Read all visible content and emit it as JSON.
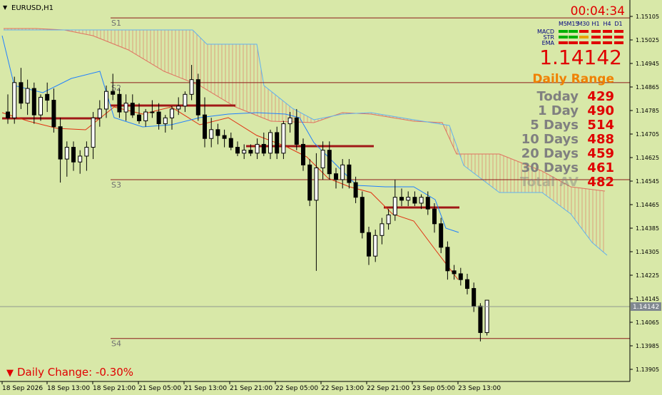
{
  "window": {
    "symbol_title": "EURUSD,H1",
    "timer": "00:04:34",
    "current_price": "1.14142",
    "price_label": "1.14142"
  },
  "indicators": {
    "timeframes": [
      "M5",
      "M15",
      "M30",
      "H1",
      "H4",
      "D1"
    ],
    "rows": [
      {
        "name": "MACD",
        "colors": [
          "#00b000",
          "#00b000",
          "#e00000",
          "#e00000",
          "#e00000",
          "#e00000"
        ]
      },
      {
        "name": "STR",
        "colors": [
          "#00b000",
          "#00b000",
          "#e8a000",
          "#e00000",
          "#e00000",
          "#e00000"
        ]
      },
      {
        "name": "EMA",
        "colors": [
          "#e00000",
          "#e00000",
          "#e00000",
          "#e00000",
          "#e00000",
          "#e00000"
        ]
      }
    ]
  },
  "daily_range": {
    "title": "Daily Range",
    "rows": [
      {
        "label": "Today",
        "value": "429"
      },
      {
        "label": "1 Day",
        "value": "490"
      },
      {
        "label": "5 Days",
        "value": "514"
      },
      {
        "label": "10 Days",
        "value": "488"
      },
      {
        "label": "20 Days",
        "value": "459"
      },
      {
        "label": "30 Days",
        "value": "461"
      },
      {
        "label": "Total AV",
        "value": "482"
      }
    ]
  },
  "daily_change": "Daily Change: -0.30%",
  "levels": [
    {
      "name": "S1",
      "price": 1.151
    },
    {
      "name": "S2",
      "price": 1.1488
    },
    {
      "name": "S3",
      "price": 1.1455
    },
    {
      "name": "S4",
      "price": 1.1401
    }
  ],
  "price_axis": [
    "1.15105",
    "1.15025",
    "1.14945",
    "1.14865",
    "1.14785",
    "1.14705",
    "1.14625",
    "1.14545",
    "1.14465",
    "1.14385",
    "1.14305",
    "1.14225",
    "1.14145",
    "1.14065",
    "1.13985",
    "1.13905"
  ],
  "time_axis": [
    "18 Sep 2026",
    "18 Sep 13:00",
    "18 Sep 21:00",
    "21 Sep 05:00",
    "21 Sep 13:00",
    "21 Sep 21:00",
    "22 Sep 05:00",
    "22 Sep 13:00",
    "22 Sep 21:00",
    "23 Sep 05:00",
    "23 Sep 13:00"
  ],
  "colors": {
    "background": "#d8e8a8",
    "bull_body": "#ffffff",
    "bear_body": "#000000",
    "level_line": "#8b1a1a",
    "pivot_bar": "#a01818",
    "kijun": "#e03010",
    "tenkan": "#2080ff",
    "cloud": "#e07060",
    "senkou_b_edge": "#60b0f0",
    "range_label": "#808080",
    "range_value": "#e00000",
    "range_title": "#f08000"
  },
  "chart_data": {
    "type": "candlestick",
    "symbol": "EURUSD",
    "timeframe": "H1",
    "ylim": [
      1.1389,
      1.1517
    ],
    "candles": [
      [
        1.1478,
        1.1484,
        1.1474,
        1.1476
      ],
      [
        1.1476,
        1.149,
        1.1474,
        1.1488
      ],
      [
        1.1488,
        1.1493,
        1.1479,
        1.1481
      ],
      [
        1.1481,
        1.1489,
        1.1477,
        1.1486
      ],
      [
        1.1486,
        1.1488,
        1.1474,
        1.1477
      ],
      [
        1.1477,
        1.1484,
        1.1475,
        1.1483
      ],
      [
        1.1484,
        1.1488,
        1.1478,
        1.1482
      ],
      [
        1.1482,
        1.1486,
        1.1471,
        1.1473
      ],
      [
        1.1473,
        1.1476,
        1.1454,
        1.1462
      ],
      [
        1.1462,
        1.1468,
        1.1456,
        1.1466
      ],
      [
        1.1466,
        1.1468,
        1.1458,
        1.1461
      ],
      [
        1.1461,
        1.1465,
        1.1457,
        1.1463
      ],
      [
        1.1463,
        1.1468,
        1.1458,
        1.1466
      ],
      [
        1.1466,
        1.1478,
        1.1462,
        1.1476
      ],
      [
        1.1476,
        1.1482,
        1.1473,
        1.1479
      ],
      [
        1.1479,
        1.1487,
        1.1476,
        1.1485
      ],
      [
        1.1485,
        1.1491,
        1.1482,
        1.1484
      ],
      [
        1.1484,
        1.1486,
        1.1476,
        1.1478
      ],
      [
        1.1478,
        1.1484,
        1.1475,
        1.1481
      ],
      [
        1.1481,
        1.1484,
        1.1476,
        1.1477
      ],
      [
        1.1477,
        1.1481,
        1.1474,
        1.1475
      ],
      [
        1.1475,
        1.1479,
        1.1473,
        1.1478
      ],
      [
        1.1478,
        1.1482,
        1.1476,
        1.1478
      ],
      [
        1.1478,
        1.1481,
        1.1472,
        1.1474
      ],
      [
        1.1474,
        1.1477,
        1.1471,
        1.1476
      ],
      [
        1.1476,
        1.148,
        1.1472,
        1.1479
      ],
      [
        1.1479,
        1.1483,
        1.1477,
        1.148
      ],
      [
        1.148,
        1.1485,
        1.1478,
        1.1484
      ],
      [
        1.1484,
        1.1494,
        1.1482,
        1.1489
      ],
      [
        1.1489,
        1.1491,
        1.1475,
        1.1477
      ],
      [
        1.1477,
        1.1483,
        1.1466,
        1.1469
      ],
      [
        1.1469,
        1.1476,
        1.1466,
        1.1472
      ],
      [
        1.1472,
        1.1474,
        1.1467,
        1.147
      ],
      [
        1.147,
        1.1472,
        1.1466,
        1.1469
      ],
      [
        1.1469,
        1.1471,
        1.1465,
        1.1466
      ],
      [
        1.1466,
        1.1468,
        1.1463,
        1.1464
      ],
      [
        1.1464,
        1.1467,
        1.1462,
        1.1465
      ],
      [
        1.1465,
        1.1467,
        1.1463,
        1.1464
      ],
      [
        1.1464,
        1.1469,
        1.1462,
        1.1467
      ],
      [
        1.1467,
        1.1471,
        1.1463,
        1.1464
      ],
      [
        1.1464,
        1.1472,
        1.1462,
        1.1471
      ],
      [
        1.1471,
        1.1473,
        1.1462,
        1.1464
      ],
      [
        1.1464,
        1.1475,
        1.1462,
        1.1474
      ],
      [
        1.1474,
        1.1478,
        1.1471,
        1.1476
      ],
      [
        1.1476,
        1.1479,
        1.1465,
        1.1467
      ],
      [
        1.1467,
        1.1469,
        1.1458,
        1.146
      ],
      [
        1.146,
        1.1462,
        1.1446,
        1.1448
      ],
      [
        1.1448,
        1.1464,
        1.1424,
        1.1459
      ],
      [
        1.1459,
        1.1468,
        1.1455,
        1.1465
      ],
      [
        1.1465,
        1.1468,
        1.1455,
        1.1457
      ],
      [
        1.1457,
        1.1459,
        1.1452,
        1.1455
      ],
      [
        1.1455,
        1.1462,
        1.1452,
        1.146
      ],
      [
        1.146,
        1.1462,
        1.1452,
        1.1454
      ],
      [
        1.1454,
        1.1456,
        1.1447,
        1.1449
      ],
      [
        1.1449,
        1.1451,
        1.1435,
        1.1437
      ],
      [
        1.1437,
        1.1439,
        1.1426,
        1.1429
      ],
      [
        1.1429,
        1.1438,
        1.1427,
        1.1436
      ],
      [
        1.1436,
        1.1442,
        1.1433,
        1.144
      ],
      [
        1.144,
        1.1445,
        1.1438,
        1.1443
      ],
      [
        1.1443,
        1.1455,
        1.1441,
        1.1449
      ],
      [
        1.1449,
        1.1452,
        1.1446,
        1.1448
      ],
      [
        1.1448,
        1.1451,
        1.1446,
        1.1449
      ],
      [
        1.1449,
        1.1451,
        1.1446,
        1.1447
      ],
      [
        1.1447,
        1.145,
        1.1445,
        1.1449
      ],
      [
        1.1449,
        1.1451,
        1.1443,
        1.1445
      ],
      [
        1.1445,
        1.1447,
        1.1437,
        1.144
      ],
      [
        1.144,
        1.1442,
        1.143,
        1.1432
      ],
      [
        1.1432,
        1.1434,
        1.1421,
        1.1424
      ],
      [
        1.1424,
        1.1426,
        1.1421,
        1.1423
      ],
      [
        1.1423,
        1.1425,
        1.1419,
        1.1421
      ],
      [
        1.1421,
        1.1423,
        1.1416,
        1.1418
      ],
      [
        1.1418,
        1.142,
        1.141,
        1.1412
      ],
      [
        1.1412,
        1.1413,
        1.14,
        1.1403
      ],
      [
        1.1403,
        1.1414,
        1.1402,
        1.1414
      ]
    ]
  }
}
